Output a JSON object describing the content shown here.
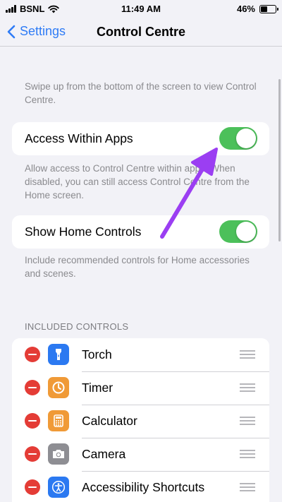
{
  "status_bar": {
    "carrier": "BSNL",
    "time": "11:49 AM",
    "battery": "46%",
    "battery_level": 0.46
  },
  "nav": {
    "back_label": "Settings",
    "title": "Control Centre"
  },
  "intro_note": "Swipe up from the bottom of the screen to view Control Centre.",
  "access_within_apps": {
    "label": "Access Within Apps",
    "enabled": true,
    "note": "Allow access to Control Centre within apps. When disabled, you can still access Control Centre from the Home screen."
  },
  "show_home_controls": {
    "label": "Show Home Controls",
    "enabled": true,
    "note": "Include recommended controls for Home accessories and scenes."
  },
  "included_controls": {
    "header": "INCLUDED CONTROLS",
    "items": [
      {
        "label": "Torch",
        "icon": "flashlight-icon",
        "color": "#2b79f1"
      },
      {
        "label": "Timer",
        "icon": "timer-icon",
        "color": "#f09a37"
      },
      {
        "label": "Calculator",
        "icon": "calculator-icon",
        "color": "#f09a37"
      },
      {
        "label": "Camera",
        "icon": "camera-icon",
        "color": "#8e8e93"
      },
      {
        "label": "Accessibility Shortcuts",
        "icon": "accessibility-icon",
        "color": "#2b79f1"
      }
    ]
  },
  "colors": {
    "accent": "#2f7cf6",
    "toggle_on": "#4cc05a",
    "remove": "#e43c36",
    "annotation_arrow": "#9b3ef2"
  }
}
